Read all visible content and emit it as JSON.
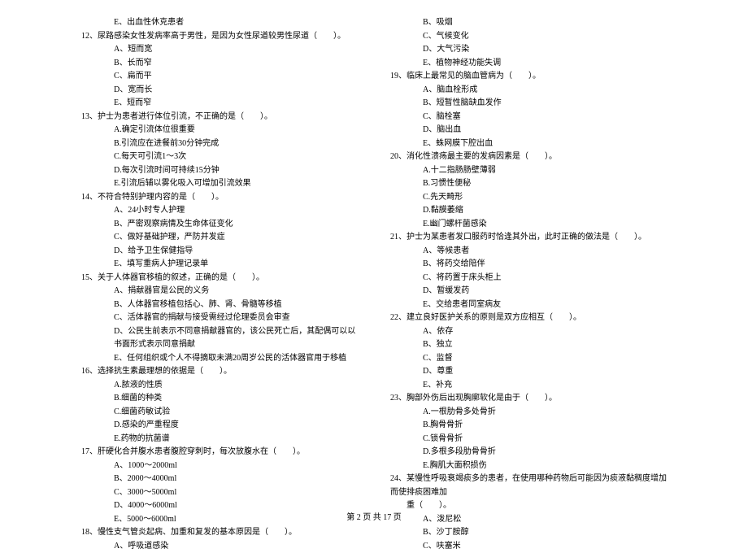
{
  "left": {
    "q11e": "E、出血性休克患者",
    "q12": "12、尿路感染女性发病率高于男性，是因为女性尿道较男性尿道（　　）。",
    "q12a": "A、短而宽",
    "q12b": "B、长而窄",
    "q12c": "C、扁而平",
    "q12d": "D、宽而长",
    "q12e": "E、短而窄",
    "q13": "13、护士为患者进行体位引流，不正确的是（　　）。",
    "q13a": "A.确定引流体位很重要",
    "q13b": "B.引流应在进餐前30分钟完成",
    "q13c": "C.每天可引流1～3次",
    "q13d": "D.每次引流时间可持续15分钟",
    "q13e": "E.引流后辅以雾化吸入可增加引流效果",
    "q14": "14、不符合特别护理内容的是（　　）。",
    "q14a": "A、24小时专人护理",
    "q14b": "B、严密观察病情及生命体征变化",
    "q14c": "C、做好基础护理，严防并发症",
    "q14d": "D、给予卫生保健指导",
    "q14e": "E、填写重病人护理记录单",
    "q15": "15、关于人体器官移植的叙述，正确的是（　　）。",
    "q15a": "A、捐献器官是公民的义务",
    "q15b": "B、人体器官移植包括心、肺、肾、骨髓等移植",
    "q15c": "C、活体器官的捐献与接受需经过伦理委员会审查",
    "q15d": "D、公民生前表示不同意捐献器官的，该公民死亡后，其配偶可以以书面形式表示同意捐献",
    "q15e": "E、任何组织或个人不得摘取未满20周岁公民的活体器官用于移植",
    "q16": "16、选择抗生素最理想的依据是（　　）。",
    "q16a": "A.脓液的性质",
    "q16b": "B.细菌的种类",
    "q16c": "C.细菌药敏试验",
    "q16d": "D.感染的严重程度",
    "q16e": "E.药物的抗菌谱",
    "q17": "17、肝硬化合并腹水患者腹腔穿刺时，每次放腹水在（　　）。",
    "q17a": "A、1000～2000ml",
    "q17b": "B、2000～4000ml",
    "q17c": "C、3000～5000ml",
    "q17d": "D、4000～6000ml",
    "q17e": "E、5000～6000ml",
    "q18": "18、慢性支气管炎起病、加重和复发的基本原因是（　　）。",
    "q18a": "A、呼吸道感染"
  },
  "right": {
    "q18b": "B、吸烟",
    "q18c": "C、气候变化",
    "q18d": "D、大气污染",
    "q18e": "E、植物神经功能失调",
    "q19": "19、临床上最常见的脑血管病为（　　）。",
    "q19a": "A、脑血栓形成",
    "q19b": "B、短暂性脑缺血发作",
    "q19c": "C、脑栓塞",
    "q19d": "D、脑出血",
    "q19e": "E、蛛网膜下腔出血",
    "q20": "20、消化性溃疡最主要的发病因素是（　　）。",
    "q20a": "A.十二指肠肠壁薄弱",
    "q20b": "B.习惯性便秘",
    "q20c": "C.先天畸形",
    "q20d": "D.黏膜萎缩",
    "q20e": "E.幽门螺杆菌感染",
    "q21": "21、护士为某患者发口服药时恰逢其外出，此时正确的做法是（　　）。",
    "q21a": "A、等候患者",
    "q21b": "B、将药交给陪伴",
    "q21c": "C、将药置于床头柜上",
    "q21d": "D、暂缓发药",
    "q21e": "E、交给患者同室病友",
    "q22": "22、建立良好医护关系的原则是双方应相互（　　）。",
    "q22a": "A、依存",
    "q22b": "B、独立",
    "q22c": "C、监督",
    "q22d": "D、尊重",
    "q22e": "E、补充",
    "q23": "23、胸部外伤后出现胸廓软化是由于（　　）。",
    "q23a": "A.一根肋骨多处骨折",
    "q23b": "B.胸骨骨折",
    "q23c": "C.锁骨骨折",
    "q23d": "D.多根多段肋骨骨折",
    "q23e": "E.胸肌大面积损伤",
    "q24": "24、某慢性呼吸衰竭痰多的患者，在使用哪种药物后可能因为痰液黏稠度增加而使排痰困难加重（　　）。",
    "q24a": "A、泼尼松",
    "q24b": "B、沙丁胺醇",
    "q24c": "C、呋塞米"
  },
  "footer": "第 2 页 共 17 页"
}
